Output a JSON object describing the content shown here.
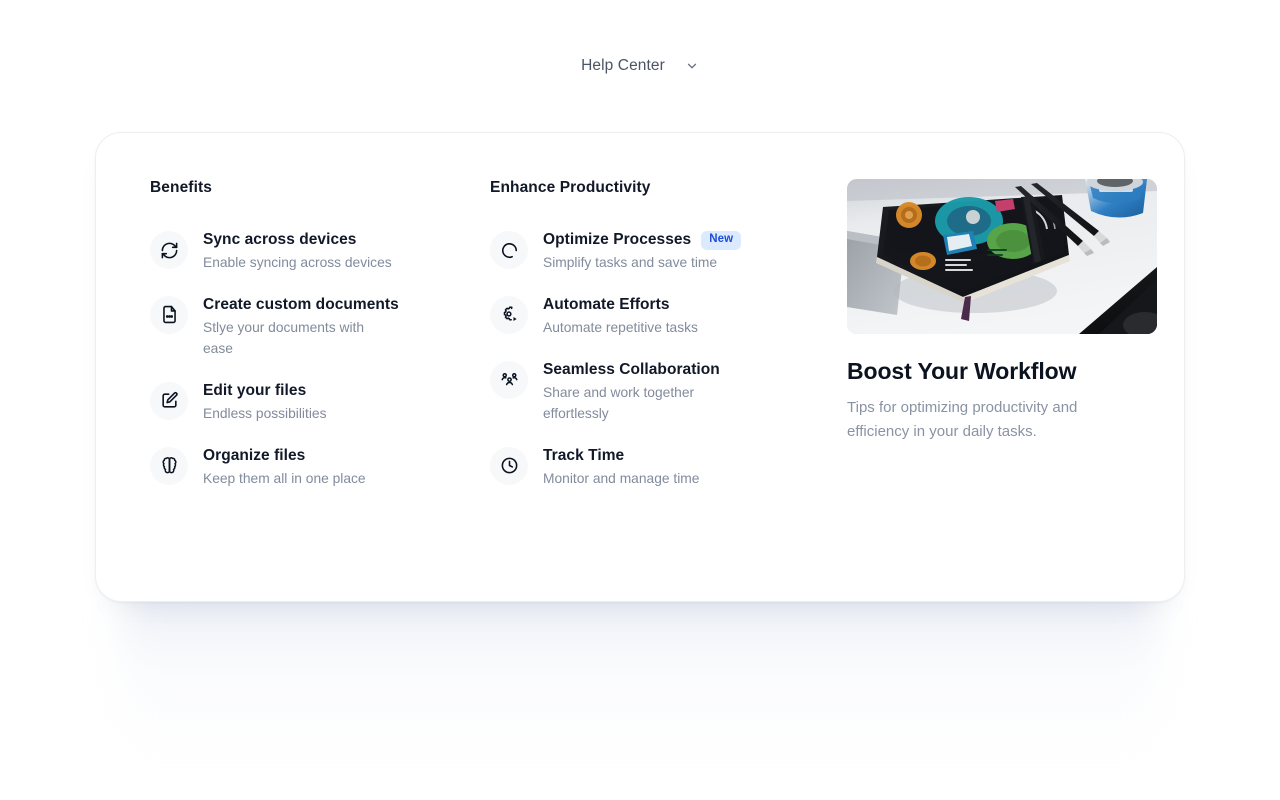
{
  "header": {
    "menu_label": "Help Center",
    "chevron_icon": "chevron-down-icon"
  },
  "columns": {
    "benefits": {
      "title": "Benefits",
      "items": [
        {
          "icon": "refresh-cw-icon",
          "title": "Sync across devices",
          "desc": "Enable syncing across devices"
        },
        {
          "icon": "file-text-icon",
          "title": "Create custom documents",
          "desc": "Stlye your documents with ease"
        },
        {
          "icon": "square-pen-icon",
          "title": "Edit your files",
          "desc": "Endless possibilities"
        },
        {
          "icon": "brain-icon",
          "title": "Organize files",
          "desc": "Keep them all in one place"
        }
      ]
    },
    "productivity": {
      "title": "Enhance Productivity",
      "items": [
        {
          "icon": "loader-circle-icon",
          "title": "Optimize Processes",
          "desc": "Simplify tasks and save time",
          "badge": "New"
        },
        {
          "icon": "settings-play-icon",
          "title": "Automate Efforts",
          "desc": "Automate repetitive tasks",
          "badge": ""
        },
        {
          "icon": "users-group-icon",
          "title": "Seamless Collaboration",
          "desc": "Share and work together effortlessly",
          "badge": ""
        },
        {
          "icon": "clock-icon",
          "title": "Track Time",
          "desc": "Monitor and manage time",
          "badge": ""
        }
      ]
    },
    "promo": {
      "image_alt": "desk-with-notebook-and-pencils-photo",
      "title": "Boost Your Workflow",
      "desc": "Tips for optimizing productivity and efficiency in your daily tasks."
    }
  },
  "colors": {
    "badge_text": "#1d4ed8",
    "badge_bg": "#dbeafe",
    "heading": "#111827",
    "muted": "#828b9c",
    "icon_bg": "#f7f8fa",
    "card_border": "#eceef2"
  }
}
